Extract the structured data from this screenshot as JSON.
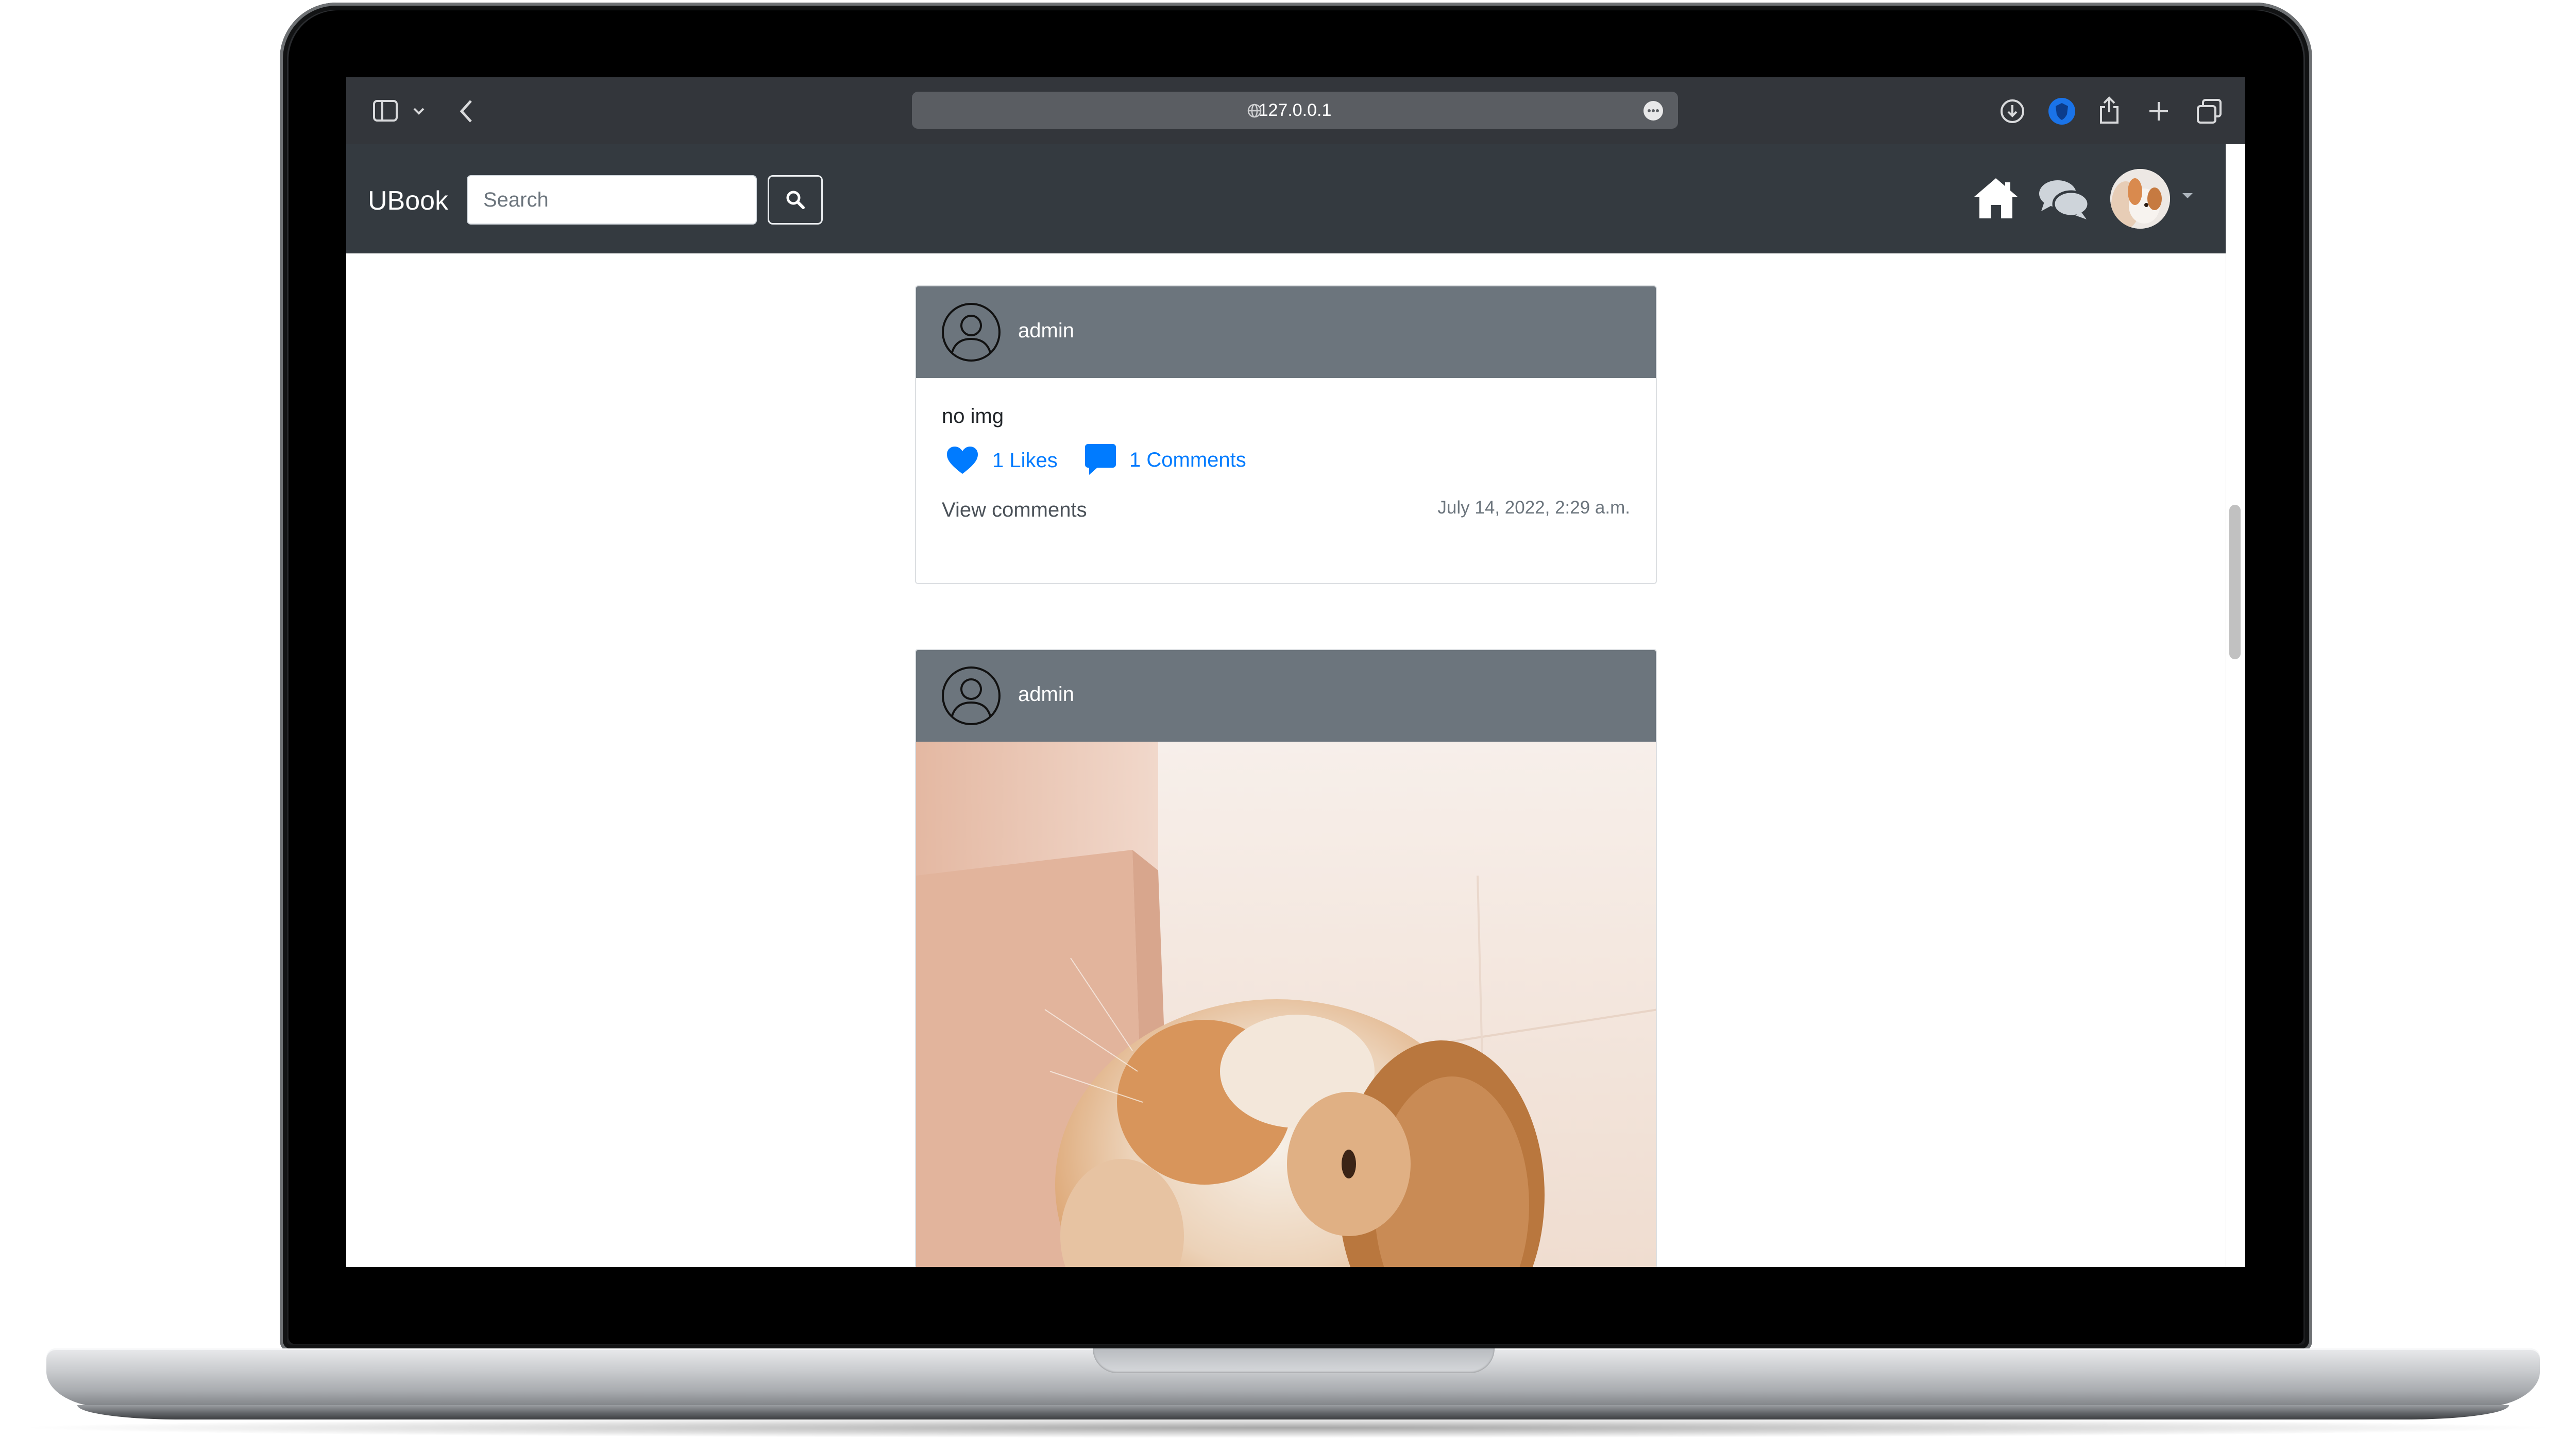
{
  "browser": {
    "address": "127.0.0.1"
  },
  "navbar": {
    "brand": "UBook",
    "search_placeholder": "Search"
  },
  "posts": [
    {
      "author": "admin",
      "text": "no img",
      "likes_label": "1 Likes",
      "comments_label": "1 Comments",
      "view_comments_label": "View comments",
      "timestamp": "July 14, 2022, 2:29 a.m."
    },
    {
      "author": "admin"
    }
  ],
  "colors": {
    "navbar": "#343a40",
    "card_header": "#6c757d",
    "link": "#007bff"
  }
}
